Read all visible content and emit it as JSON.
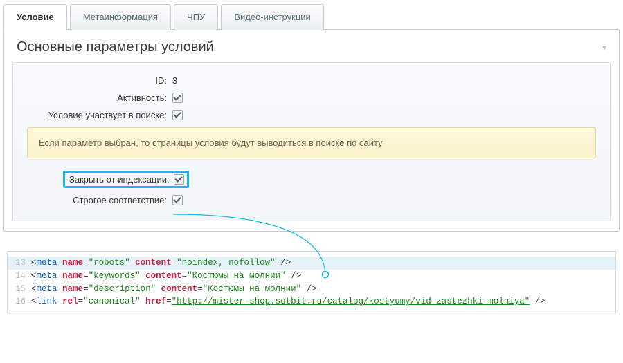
{
  "tabs": {
    "t0": "Условие",
    "t1": "Метаинформация",
    "t2": "ЧПУ",
    "t3": "Видео-инструкции"
  },
  "panel": {
    "title": "Основные параметры условий"
  },
  "form": {
    "id_label": "ID:",
    "id_value": "3",
    "active_label": "Активность:",
    "search_label": "Условие участвует в поиске:",
    "note": "Если параметр выбран, то страницы условия будут выводиться в поиске по сайту",
    "noindex_label": "Закрыть от индексации:",
    "strict_label": "Строгое соответствие:"
  },
  "code": {
    "lines": [
      {
        "n": "13",
        "hl": true,
        "tag": "meta",
        "pairs": [
          [
            "name",
            "\"robots\""
          ],
          [
            "content",
            "\"noindex, nofollow\""
          ]
        ],
        "self": true
      },
      {
        "n": "14",
        "hl": false,
        "tag": "meta",
        "pairs": [
          [
            "name",
            "\"keywords\""
          ],
          [
            "content",
            "\"Костюмы на молнии\""
          ]
        ],
        "self": true
      },
      {
        "n": "15",
        "hl": false,
        "tag": "meta",
        "pairs": [
          [
            "name",
            "\"description\""
          ],
          [
            "content",
            "\"Костюмы на молнии\""
          ]
        ],
        "self": true
      },
      {
        "n": "16",
        "hl": false,
        "tag": "link",
        "pairs": [
          [
            "rel",
            "\"canonical\""
          ],
          [
            "href",
            "\"http://mister-shop.sotbit.ru/catalog/kostyumy/vid_zastezhki_molniya\""
          ]
        ],
        "self": true,
        "urlAttr": "href"
      }
    ]
  }
}
